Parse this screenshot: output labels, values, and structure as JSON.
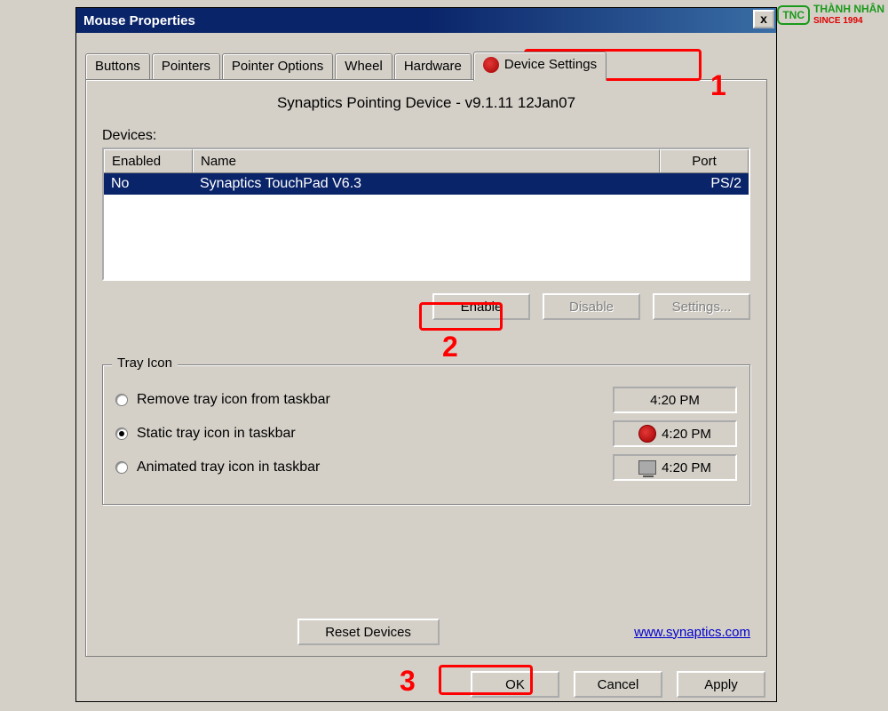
{
  "window": {
    "title": "Mouse Properties",
    "close": "x"
  },
  "tabs": {
    "buttons": "Buttons",
    "pointers": "Pointers",
    "pointer_options": "Pointer Options",
    "wheel": "Wheel",
    "hardware": "Hardware",
    "device_settings": "Device Settings"
  },
  "panel": {
    "title": "Synaptics Pointing Device - v9.1.11 12Jan07",
    "devices_label": "Devices:",
    "columns": {
      "enabled": "Enabled",
      "name": "Name",
      "port": "Port"
    },
    "row": {
      "enabled": "No",
      "name": "Synaptics TouchPad V6.3",
      "port": "PS/2"
    },
    "buttons": {
      "enable": "Enable",
      "disable": "Disable",
      "settings": "Settings..."
    }
  },
  "tray": {
    "legend": "Tray Icon",
    "opt_remove": "Remove tray icon from taskbar",
    "opt_static": "Static tray icon in taskbar",
    "opt_animated": "Animated tray icon in taskbar",
    "time1": "4:20 PM",
    "time2": "4:20 PM",
    "time3": "4:20 PM"
  },
  "bottom": {
    "reset": "Reset Devices",
    "link": "www.synaptics.com"
  },
  "dialog_buttons": {
    "ok": "OK",
    "cancel": "Cancel",
    "apply": "Apply"
  },
  "annotations": {
    "n1": "1",
    "n2": "2",
    "n3": "3"
  },
  "logo": {
    "badge": "TNC",
    "line1": "THÀNH NHÂN",
    "line2": "SINCE 1994"
  }
}
